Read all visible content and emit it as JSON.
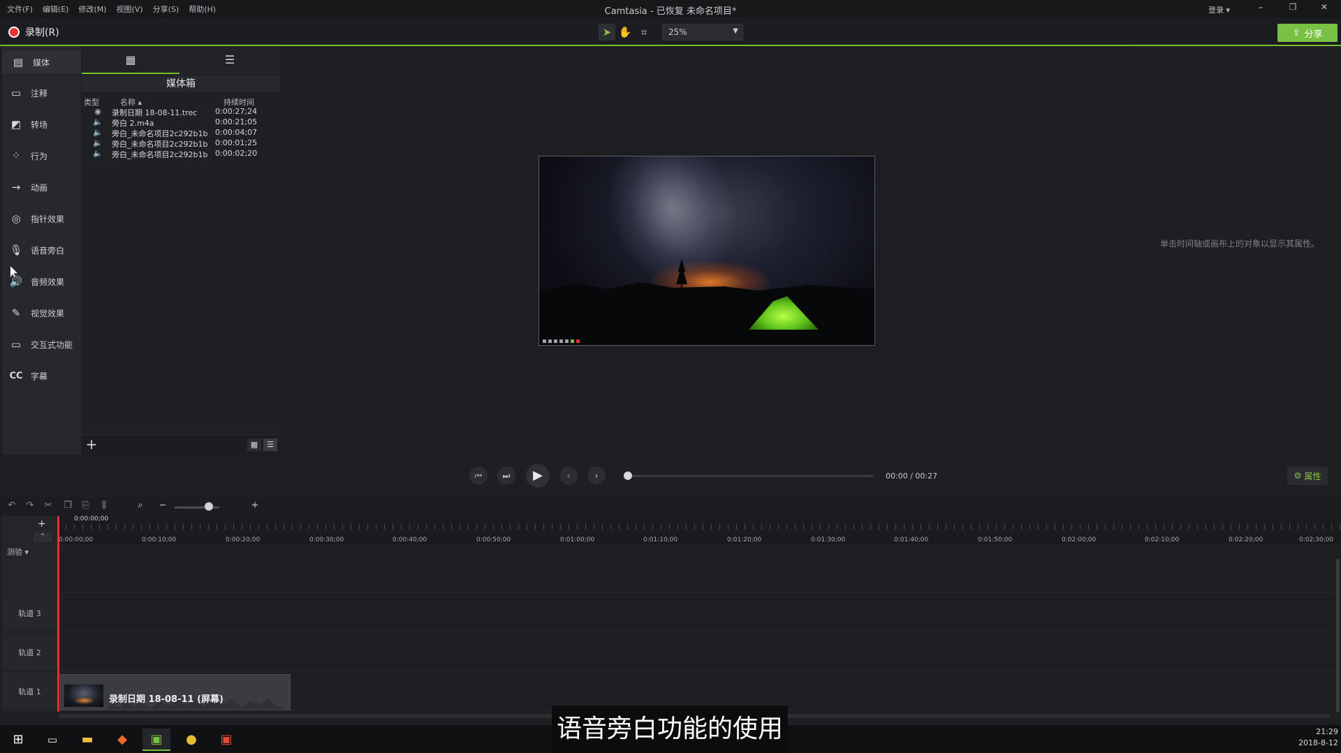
{
  "menu": [
    "文件(F)",
    "编辑(E)",
    "修改(M)",
    "视图(V)",
    "分享(S)",
    "帮助(H)"
  ],
  "window_title": "Camtasia - 已恢复  未命名项目*",
  "login": "登录 ▾",
  "window_controls": {
    "minimize": "–",
    "restore": "❐",
    "close": "✕"
  },
  "record_label": "录制(R)",
  "zoom_level": "25%",
  "share_label": "分享",
  "share_icon": "upload-icon",
  "rail": [
    {
      "label": "媒体",
      "icon": "media-icon"
    },
    {
      "label": "注释",
      "icon": "annotation-icon"
    },
    {
      "label": "转场",
      "icon": "transition-icon"
    },
    {
      "label": "行为",
      "icon": "behavior-icon"
    },
    {
      "label": "动画",
      "icon": "animation-icon"
    },
    {
      "label": "指针效果",
      "icon": "cursor-effect-icon"
    },
    {
      "label": "语音旁白",
      "icon": "microphone-icon"
    },
    {
      "label": "音频效果",
      "icon": "audio-effect-icon"
    },
    {
      "label": "视觉效果",
      "icon": "visual-effect-icon"
    },
    {
      "label": "交互式功能",
      "icon": "interactive-icon"
    },
    {
      "label": "字幕",
      "icon": "cc-icon"
    }
  ],
  "cc_label": "CC",
  "bin": {
    "title": "媒体箱",
    "columns": {
      "type": "类型",
      "name": "名称 ▴",
      "duration": "持续时间"
    },
    "rows": [
      {
        "icon": "◉",
        "name": "录制日期 18-08-11.trec",
        "duration": "0:00:27;24"
      },
      {
        "icon": "🔈",
        "name": "旁白 2.m4a",
        "duration": "0:00:21;05"
      },
      {
        "icon": "🔈",
        "name": "旁白_未命名项目2c292b1b",
        "duration": "0:00:04;07"
      },
      {
        "icon": "🔈",
        "name": "旁白_未命名项目2c292b1b",
        "duration": "0:00:01;25"
      },
      {
        "icon": "🔈",
        "name": "旁白_未命名项目2c292b1b",
        "duration": "0:00:02;20"
      }
    ]
  },
  "properties_hint": "单击时间轴或画布上的对象以显示其属性。",
  "player": {
    "current": "00:00",
    "separator": "/",
    "total": "00:27",
    "properties_label": "属性"
  },
  "timeline": {
    "playhead_time": "0:00:00;00",
    "measure_label": "测验",
    "ruler_labels": [
      "0:00:00;00",
      "0:00:10;00",
      "0:00:20;00",
      "0:00:30;00",
      "0:00:40;00",
      "0:00:50;00",
      "0:01:00;00",
      "0:01:10;00",
      "0:01:20;00",
      "0:01:30;00",
      "0:01:40;00",
      "0:01:50;00",
      "0:02:00;00",
      "0:02:10;00",
      "0:02:20;00",
      "0:02:30;00"
    ],
    "tracks": [
      "轨道 3",
      "轨道 2",
      "轨道 1"
    ],
    "clip_label": "录制日期 18-08-11 (屏幕)"
  },
  "subtitle": "语音旁白功能的使用",
  "clock": {
    "time": "21:29",
    "date": "2018-8-12"
  },
  "colors": {
    "accent": "#7cbf2a",
    "record": "#e8303a",
    "playhead": "#e4303a"
  }
}
